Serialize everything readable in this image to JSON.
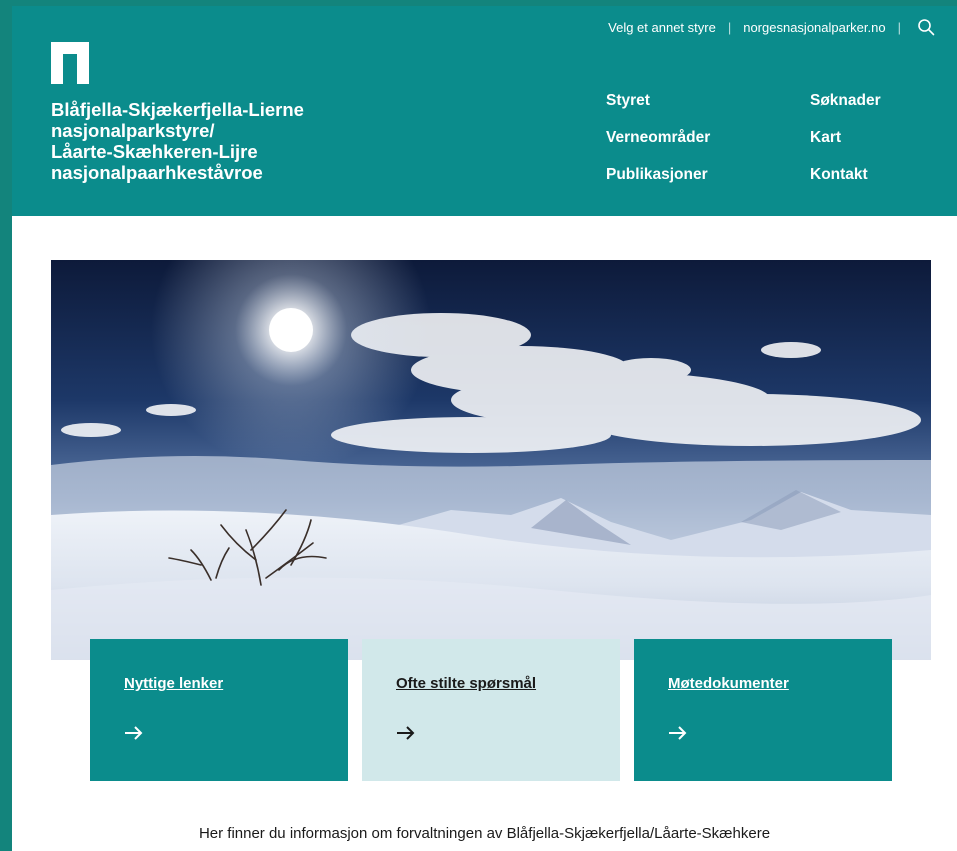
{
  "site": {
    "title_lines": [
      "Blåfjella-Skjækerfjella-Lierne",
      "nasjonalparkstyre/",
      "Låarte-Skæhkeren-Lijre",
      "nasjonalpaarhkeståvroe"
    ]
  },
  "utility": {
    "select_board": "Velg et annet styre",
    "parks_link": "norgesnasjonalparker.no",
    "separator": "|",
    "search_icon": "search-icon"
  },
  "nav": {
    "items": [
      "Styret",
      "Søknader",
      "Verneområder",
      "Kart",
      "Publikasjoner",
      "Kontakt"
    ]
  },
  "cards": [
    {
      "title": "Nyttige lenker",
      "arrow": "→",
      "style": "teal"
    },
    {
      "title": "Ofte stilte spørsmål",
      "arrow": "→",
      "style": "light"
    },
    {
      "title": "Møtedokumenter",
      "arrow": "→",
      "style": "teal"
    }
  ],
  "intro": {
    "text": "Her finner du informasjon om forvaltningen av Blåfjella-Skjækerfjella/Låarte-Skæhkere"
  },
  "colors": {
    "brand_teal": "#0b8c8c",
    "card_light": "#d1e8ea",
    "outer_bg": "#13847c"
  }
}
